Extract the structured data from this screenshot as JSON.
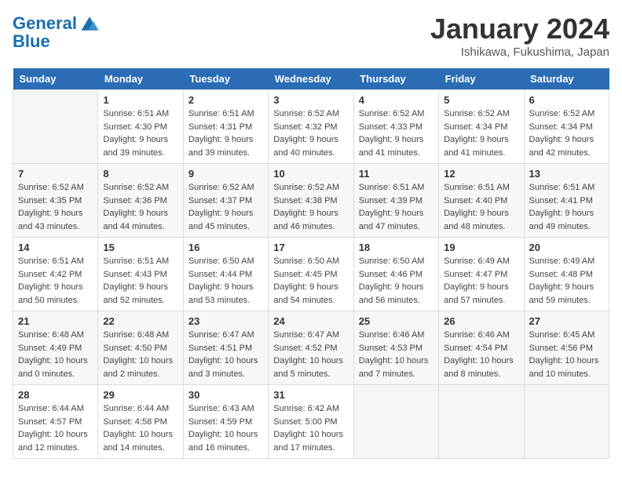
{
  "header": {
    "logo_line1": "General",
    "logo_line2": "Blue",
    "month_title": "January 2024",
    "location": "Ishikawa, Fukushima, Japan"
  },
  "days_of_week": [
    "Sunday",
    "Monday",
    "Tuesday",
    "Wednesday",
    "Thursday",
    "Friday",
    "Saturday"
  ],
  "weeks": [
    [
      {
        "day": "",
        "info": ""
      },
      {
        "day": "1",
        "info": "Sunrise: 6:51 AM\nSunset: 4:30 PM\nDaylight: 9 hours\nand 39 minutes."
      },
      {
        "day": "2",
        "info": "Sunrise: 6:51 AM\nSunset: 4:31 PM\nDaylight: 9 hours\nand 39 minutes."
      },
      {
        "day": "3",
        "info": "Sunrise: 6:52 AM\nSunset: 4:32 PM\nDaylight: 9 hours\nand 40 minutes."
      },
      {
        "day": "4",
        "info": "Sunrise: 6:52 AM\nSunset: 4:33 PM\nDaylight: 9 hours\nand 41 minutes."
      },
      {
        "day": "5",
        "info": "Sunrise: 6:52 AM\nSunset: 4:34 PM\nDaylight: 9 hours\nand 41 minutes."
      },
      {
        "day": "6",
        "info": "Sunrise: 6:52 AM\nSunset: 4:34 PM\nDaylight: 9 hours\nand 42 minutes."
      }
    ],
    [
      {
        "day": "7",
        "info": "Sunrise: 6:52 AM\nSunset: 4:35 PM\nDaylight: 9 hours\nand 43 minutes."
      },
      {
        "day": "8",
        "info": "Sunrise: 6:52 AM\nSunset: 4:36 PM\nDaylight: 9 hours\nand 44 minutes."
      },
      {
        "day": "9",
        "info": "Sunrise: 6:52 AM\nSunset: 4:37 PM\nDaylight: 9 hours\nand 45 minutes."
      },
      {
        "day": "10",
        "info": "Sunrise: 6:52 AM\nSunset: 4:38 PM\nDaylight: 9 hours\nand 46 minutes."
      },
      {
        "day": "11",
        "info": "Sunrise: 6:51 AM\nSunset: 4:39 PM\nDaylight: 9 hours\nand 47 minutes."
      },
      {
        "day": "12",
        "info": "Sunrise: 6:51 AM\nSunset: 4:40 PM\nDaylight: 9 hours\nand 48 minutes."
      },
      {
        "day": "13",
        "info": "Sunrise: 6:51 AM\nSunset: 4:41 PM\nDaylight: 9 hours\nand 49 minutes."
      }
    ],
    [
      {
        "day": "14",
        "info": "Sunrise: 6:51 AM\nSunset: 4:42 PM\nDaylight: 9 hours\nand 50 minutes."
      },
      {
        "day": "15",
        "info": "Sunrise: 6:51 AM\nSunset: 4:43 PM\nDaylight: 9 hours\nand 52 minutes."
      },
      {
        "day": "16",
        "info": "Sunrise: 6:50 AM\nSunset: 4:44 PM\nDaylight: 9 hours\nand 53 minutes."
      },
      {
        "day": "17",
        "info": "Sunrise: 6:50 AM\nSunset: 4:45 PM\nDaylight: 9 hours\nand 54 minutes."
      },
      {
        "day": "18",
        "info": "Sunrise: 6:50 AM\nSunset: 4:46 PM\nDaylight: 9 hours\nand 56 minutes."
      },
      {
        "day": "19",
        "info": "Sunrise: 6:49 AM\nSunset: 4:47 PM\nDaylight: 9 hours\nand 57 minutes."
      },
      {
        "day": "20",
        "info": "Sunrise: 6:49 AM\nSunset: 4:48 PM\nDaylight: 9 hours\nand 59 minutes."
      }
    ],
    [
      {
        "day": "21",
        "info": "Sunrise: 6:48 AM\nSunset: 4:49 PM\nDaylight: 10 hours\nand 0 minutes."
      },
      {
        "day": "22",
        "info": "Sunrise: 6:48 AM\nSunset: 4:50 PM\nDaylight: 10 hours\nand 2 minutes."
      },
      {
        "day": "23",
        "info": "Sunrise: 6:47 AM\nSunset: 4:51 PM\nDaylight: 10 hours\nand 3 minutes."
      },
      {
        "day": "24",
        "info": "Sunrise: 6:47 AM\nSunset: 4:52 PM\nDaylight: 10 hours\nand 5 minutes."
      },
      {
        "day": "25",
        "info": "Sunrise: 6:46 AM\nSunset: 4:53 PM\nDaylight: 10 hours\nand 7 minutes."
      },
      {
        "day": "26",
        "info": "Sunrise: 6:46 AM\nSunset: 4:54 PM\nDaylight: 10 hours\nand 8 minutes."
      },
      {
        "day": "27",
        "info": "Sunrise: 6:45 AM\nSunset: 4:56 PM\nDaylight: 10 hours\nand 10 minutes."
      }
    ],
    [
      {
        "day": "28",
        "info": "Sunrise: 6:44 AM\nSunset: 4:57 PM\nDaylight: 10 hours\nand 12 minutes."
      },
      {
        "day": "29",
        "info": "Sunrise: 6:44 AM\nSunset: 4:58 PM\nDaylight: 10 hours\nand 14 minutes."
      },
      {
        "day": "30",
        "info": "Sunrise: 6:43 AM\nSunset: 4:59 PM\nDaylight: 10 hours\nand 16 minutes."
      },
      {
        "day": "31",
        "info": "Sunrise: 6:42 AM\nSunset: 5:00 PM\nDaylight: 10 hours\nand 17 minutes."
      },
      {
        "day": "",
        "info": ""
      },
      {
        "day": "",
        "info": ""
      },
      {
        "day": "",
        "info": ""
      }
    ]
  ]
}
